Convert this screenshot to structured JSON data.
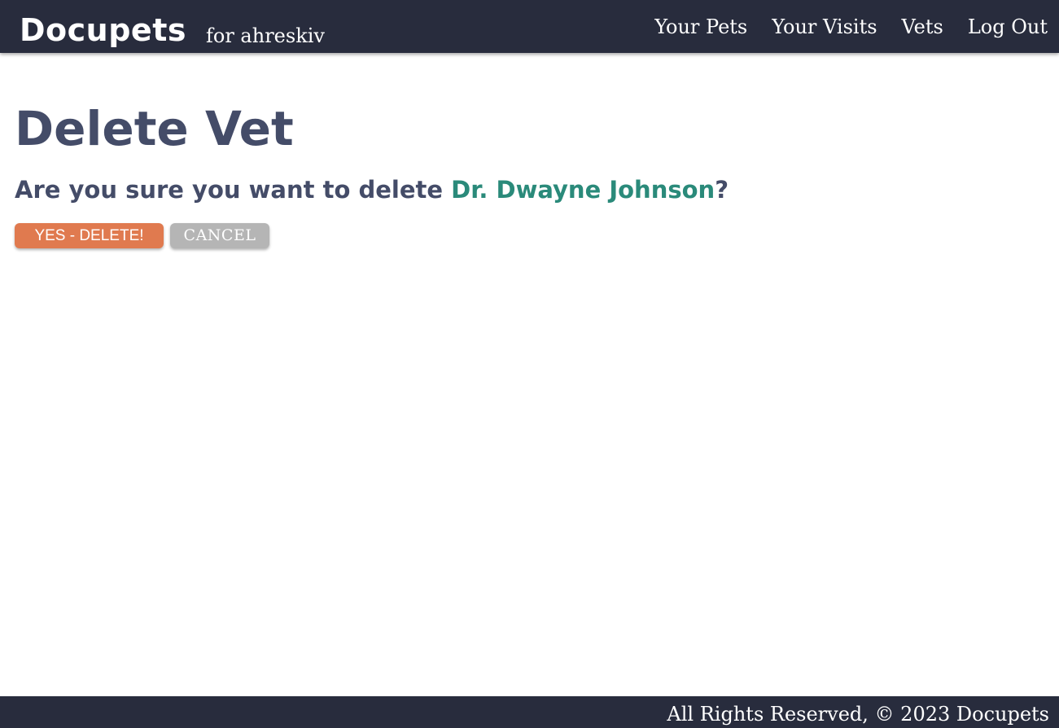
{
  "header": {
    "brand": "Docupets",
    "subtitle": "for ahreskiv",
    "nav": [
      "Your Pets",
      "Your Visits",
      "Vets",
      "Log Out"
    ]
  },
  "main": {
    "title": "Delete Vet",
    "confirm_prefix": "Are you sure you want to delete ",
    "vet_name": "Dr. Dwayne Johnson",
    "confirm_suffix": "?",
    "delete_label": "YES - DELETE!",
    "cancel_label": "CANCEL"
  },
  "footer": {
    "text": "All Rights Reserved, © 2023 Docupets"
  },
  "colors": {
    "navbar": "#282c3d",
    "heading": "#444c68",
    "accent": "#2a8a7a",
    "delete": "#e07a4f",
    "cancel": "#b5b5b5"
  }
}
